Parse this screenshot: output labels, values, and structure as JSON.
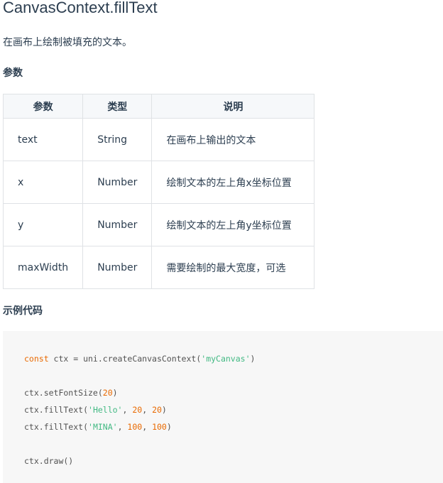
{
  "title": "CanvasContext.fillText",
  "description": "在画布上绘制被填充的文本。",
  "params_heading": "参数",
  "params_table": {
    "headers": [
      "参数",
      "类型",
      "说明"
    ],
    "rows": [
      {
        "name": "text",
        "type": "String",
        "desc": "在画布上输出的文本"
      },
      {
        "name": "x",
        "type": "Number",
        "desc": "绘制文本的左上角x坐标位置"
      },
      {
        "name": "y",
        "type": "Number",
        "desc": "绘制文本的左上角y坐标位置"
      },
      {
        "name": "maxWidth",
        "type": "Number",
        "desc": "需要绘制的最大宽度，可选"
      }
    ]
  },
  "example_heading": "示例代码",
  "code": {
    "line1": {
      "kw": "const",
      "rest": " ctx = uni.createCanvasContext(",
      "str": "'myCanvas'",
      "end": ")"
    },
    "line2": {
      "pre": "ctx.setFontSize(",
      "num": "20",
      "end": ")"
    },
    "line3": {
      "pre": "ctx.fillText(",
      "str": "'Hello'",
      "sep1": ", ",
      "num1": "20",
      "sep2": ", ",
      "num2": "20",
      "end": ")"
    },
    "line4": {
      "pre": "ctx.fillText(",
      "str": "'MINA'",
      "sep1": ", ",
      "num1": "100",
      "sep2": ", ",
      "num2": "100",
      "end": ")"
    },
    "line5": {
      "text": "ctx.draw()"
    }
  },
  "colors": {
    "text": "#2c3e50",
    "keyword": "#e96900",
    "string": "#42b983",
    "code_bg": "#f7f7f7",
    "table_border": "#dfe2e5",
    "table_header_bg": "#f6f8fa"
  }
}
